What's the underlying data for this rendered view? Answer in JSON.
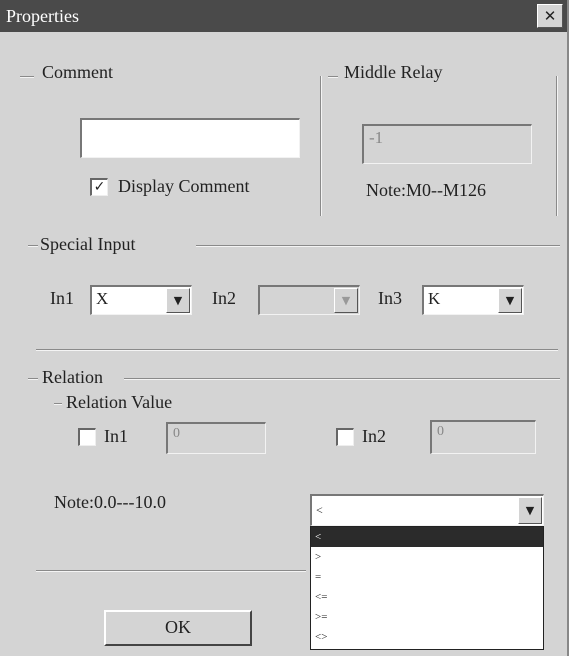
{
  "window": {
    "title": "Properties",
    "close_glyph": "✕"
  },
  "comment": {
    "group_label": "Comment",
    "value": "",
    "display_checked": true,
    "display_label": "Display Comment"
  },
  "middle_relay": {
    "group_label": "Middle Relay",
    "value": "-1",
    "note": "Note:M0--M126"
  },
  "special_input": {
    "group_label": "Special Input",
    "in1": {
      "label": "In1",
      "value": "X"
    },
    "in2": {
      "label": "In2",
      "value": ""
    },
    "in3": {
      "label": "In3",
      "value": "K"
    }
  },
  "relation": {
    "group_label": "Relation",
    "value_label": "Relation Value",
    "in1": {
      "label": "In1",
      "checked": false,
      "value": "0"
    },
    "in2": {
      "label": "In2",
      "checked": false,
      "value": "0"
    },
    "note": "Note:0.0---10.0",
    "operator_selected": "<",
    "operator_options": [
      "<",
      ">",
      "=",
      "<=",
      ">=",
      "<>"
    ],
    "operator_selected_index": 0
  },
  "buttons": {
    "ok_label": "OK"
  },
  "icons": {
    "checkmark": "check-icon",
    "dropdown": "chevron-down-icon",
    "close": "close-icon"
  }
}
